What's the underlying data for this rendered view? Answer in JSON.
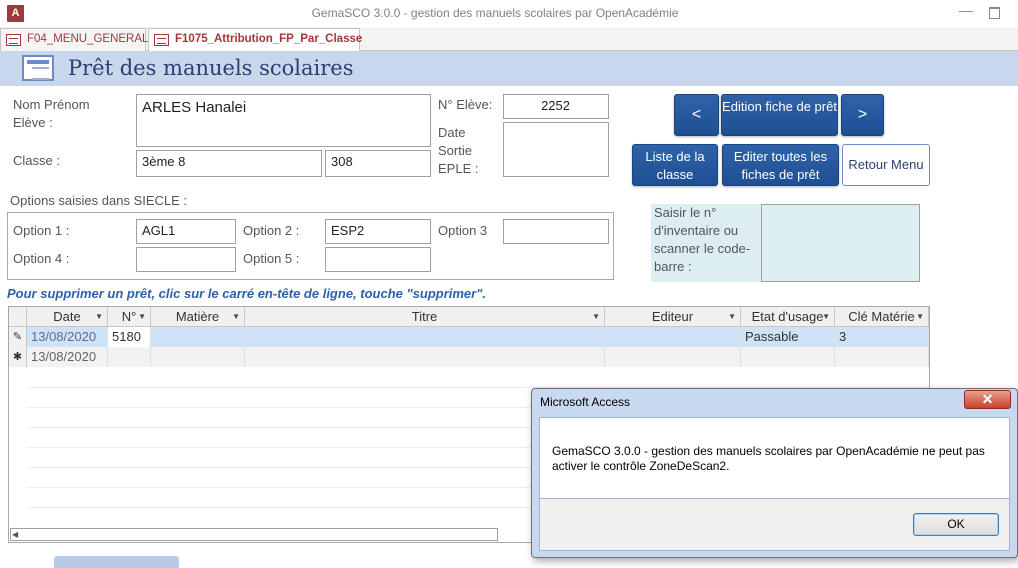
{
  "window": {
    "title": "GemaSCO 3.0.0 - gestion des manuels scolaires par OpenAcadémie",
    "app_icon": "A",
    "minimize": "—"
  },
  "tabs": [
    {
      "label": "F04_MENU_GENERAL"
    },
    {
      "label": "F1075_Attribution_FP_Par_Classe"
    }
  ],
  "form": {
    "title": "Prêt des manuels scolaires",
    "nom_label": "Nom Prénom Elève :",
    "nom_value": "ARLES Hanalei",
    "classe_label": "Classe :",
    "classe_value": "3ème 8",
    "classe_code": "308",
    "num_eleve_label": "N° Elève:",
    "num_eleve_value": "2252",
    "date_sortie_label": "Date Sortie EPLE :",
    "date_sortie_value": ""
  },
  "buttons": {
    "prev": "<",
    "edition": "Edition fiche de prêt",
    "next": ">",
    "liste_classe": "Liste de la classe",
    "editer_toutes": "Editer toutes les fiches de prêt",
    "retour_menu": "Retour Menu"
  },
  "options": {
    "section_label": "Options saisies dans SIECLE :",
    "o1_label": "Option 1 :",
    "o1_value": "AGL1",
    "o2_label": "Option 2 :",
    "o2_value": "ESP2",
    "o3_label": "Option 3",
    "o3_value": "",
    "o4_label": "Option 4 :",
    "o4_value": "",
    "o5_label": "Option 5 :",
    "o5_value": ""
  },
  "scan": {
    "label": "Saisir le n° d'inventaire ou scanner le code-barre :",
    "value": ""
  },
  "notice": "Pour supprimer un prêt, clic sur le carré en-tête de ligne, touche \"supprimer\".",
  "grid": {
    "columns": [
      "Date",
      "N°",
      "Matière",
      "Titre",
      "Editeur",
      "Etat d'usage",
      "Clé Matérie"
    ],
    "rows": [
      {
        "marker": "✎",
        "date": "13/08/2020",
        "num": "5180",
        "matiere": "",
        "titre": "",
        "editeur": "",
        "etat": "Passable",
        "cle": "3"
      },
      {
        "marker": "✱",
        "date": "13/08/2020",
        "num": "",
        "matiere": "",
        "titre": "",
        "editeur": "",
        "etat": "",
        "cle": ""
      }
    ]
  },
  "dialog": {
    "title": "Microsoft Access",
    "close": "✕",
    "message": "GemaSCO 3.0.0 - gestion des manuels scolaires par OpenAcadémie ne peut pas activer le contrôle ZoneDeScan2.",
    "ok": "OK"
  },
  "colors": {
    "header_band": "#c9d7ec",
    "button_blue": "#2556a0",
    "selected_row": "#cfe3f7",
    "scan_bg": "#dceef2",
    "accent_red": "#a4373a"
  }
}
